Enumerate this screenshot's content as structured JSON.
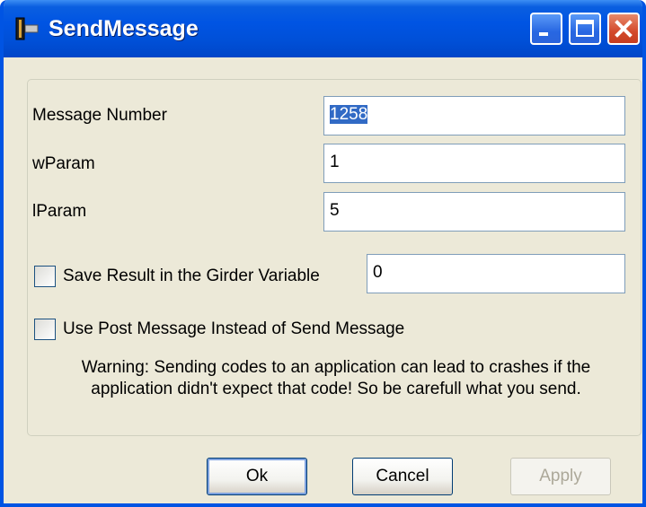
{
  "window": {
    "title": "SendMessage"
  },
  "form": {
    "message_number_label": "Message Number",
    "message_number_value": "1258",
    "wparam_label": "wParam",
    "wparam_value": "1",
    "lparam_label": "lParam",
    "lparam_value": "5",
    "save_result_label": "Save Result in the Girder Variable",
    "save_result_checked": false,
    "save_result_value": "0",
    "post_message_label": "Use Post Message Instead of Send Message",
    "post_message_checked": false,
    "warning_line1": "Warning: Sending codes to an application can lead to crashes if the",
    "warning_line2": "application didn't expect that code! So be carefull what you send."
  },
  "buttons": {
    "ok": "Ok",
    "cancel": "Cancel",
    "apply": "Apply"
  },
  "colors": {
    "titlebar": "#0054e3",
    "dialog_bg": "#ece9d8",
    "selection": "#316ac5",
    "close_button": "#d3492b"
  }
}
